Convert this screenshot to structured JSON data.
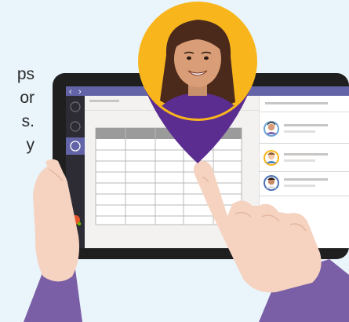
{
  "text_fragments": [
    "ps",
    "or",
    "s.",
    "y"
  ],
  "tablet": {
    "nav_back_glyph": "‹",
    "nav_forward_glyph": "›"
  },
  "colors": {
    "background": "#e9f4fb",
    "tablet_frame": "#1f1f1f",
    "title_bar": "#6264a7",
    "sidebar": "#2d2c34",
    "sidebar_active": "#6264a7",
    "pin": "#f8b61c",
    "pin_shirt": "#5c2d91",
    "sleeve": "#7b5fa6",
    "skin_hand": "#f6d3c0",
    "hair": "#4b2a1c"
  },
  "icons": [
    "back-arrow-icon",
    "forward-arrow-icon",
    "user-avatar-icon",
    "location-pin-icon"
  ]
}
